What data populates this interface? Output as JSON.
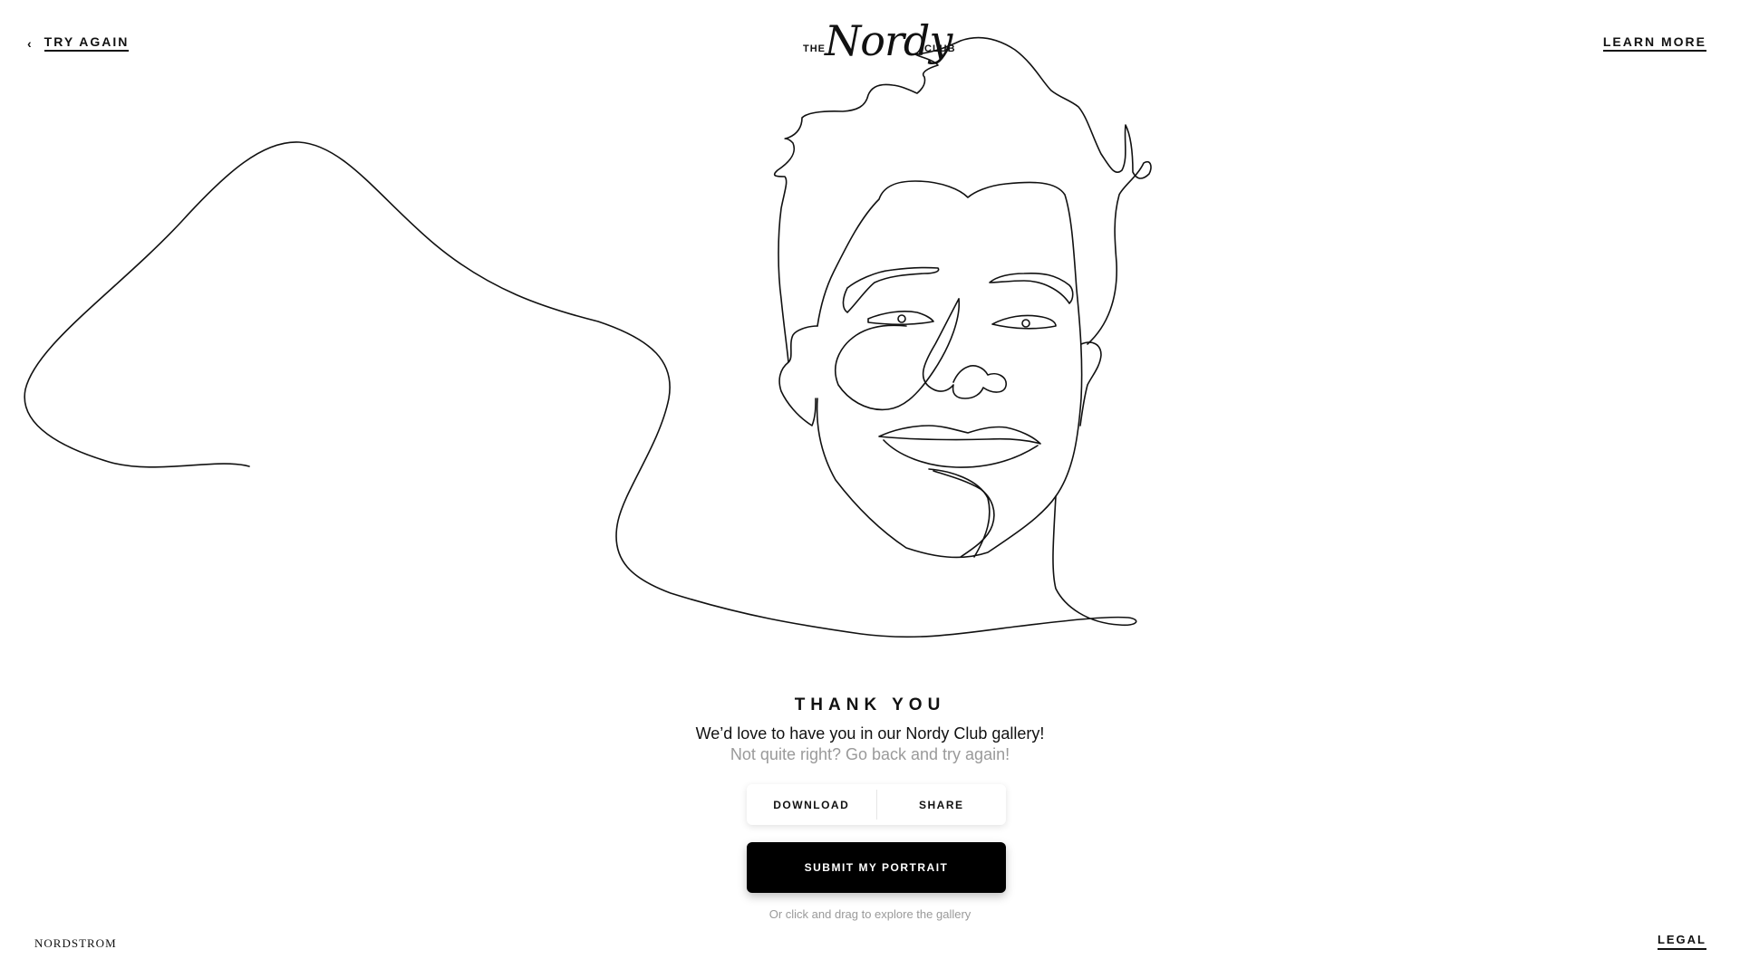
{
  "nav": {
    "back_icon": "chevron-left-icon",
    "try_again": "TRY AGAIN",
    "learn_more": "LEARN MORE"
  },
  "logo": {
    "the": "THE",
    "script": "Nordy",
    "club": "CLUB"
  },
  "portrait": {
    "description_icon": "line-art-portrait"
  },
  "result": {
    "heading": "THANK YOU",
    "message": "We’d love to have you in our Nordy Club gallery!",
    "retry_note": "Not quite right? Go back and try again!"
  },
  "actions": {
    "download": "DOWNLOAD",
    "share": "SHARE",
    "submit": "SUBMIT MY PORTRAIT"
  },
  "hint": "Or click and drag to explore the gallery",
  "footer": {
    "brand": "NORDSTROM",
    "legal": "LEGAL"
  },
  "colors": {
    "background": "#ffffff",
    "text": "#111111",
    "muted": "#9a9a9a",
    "submit_bg": "#000000"
  }
}
